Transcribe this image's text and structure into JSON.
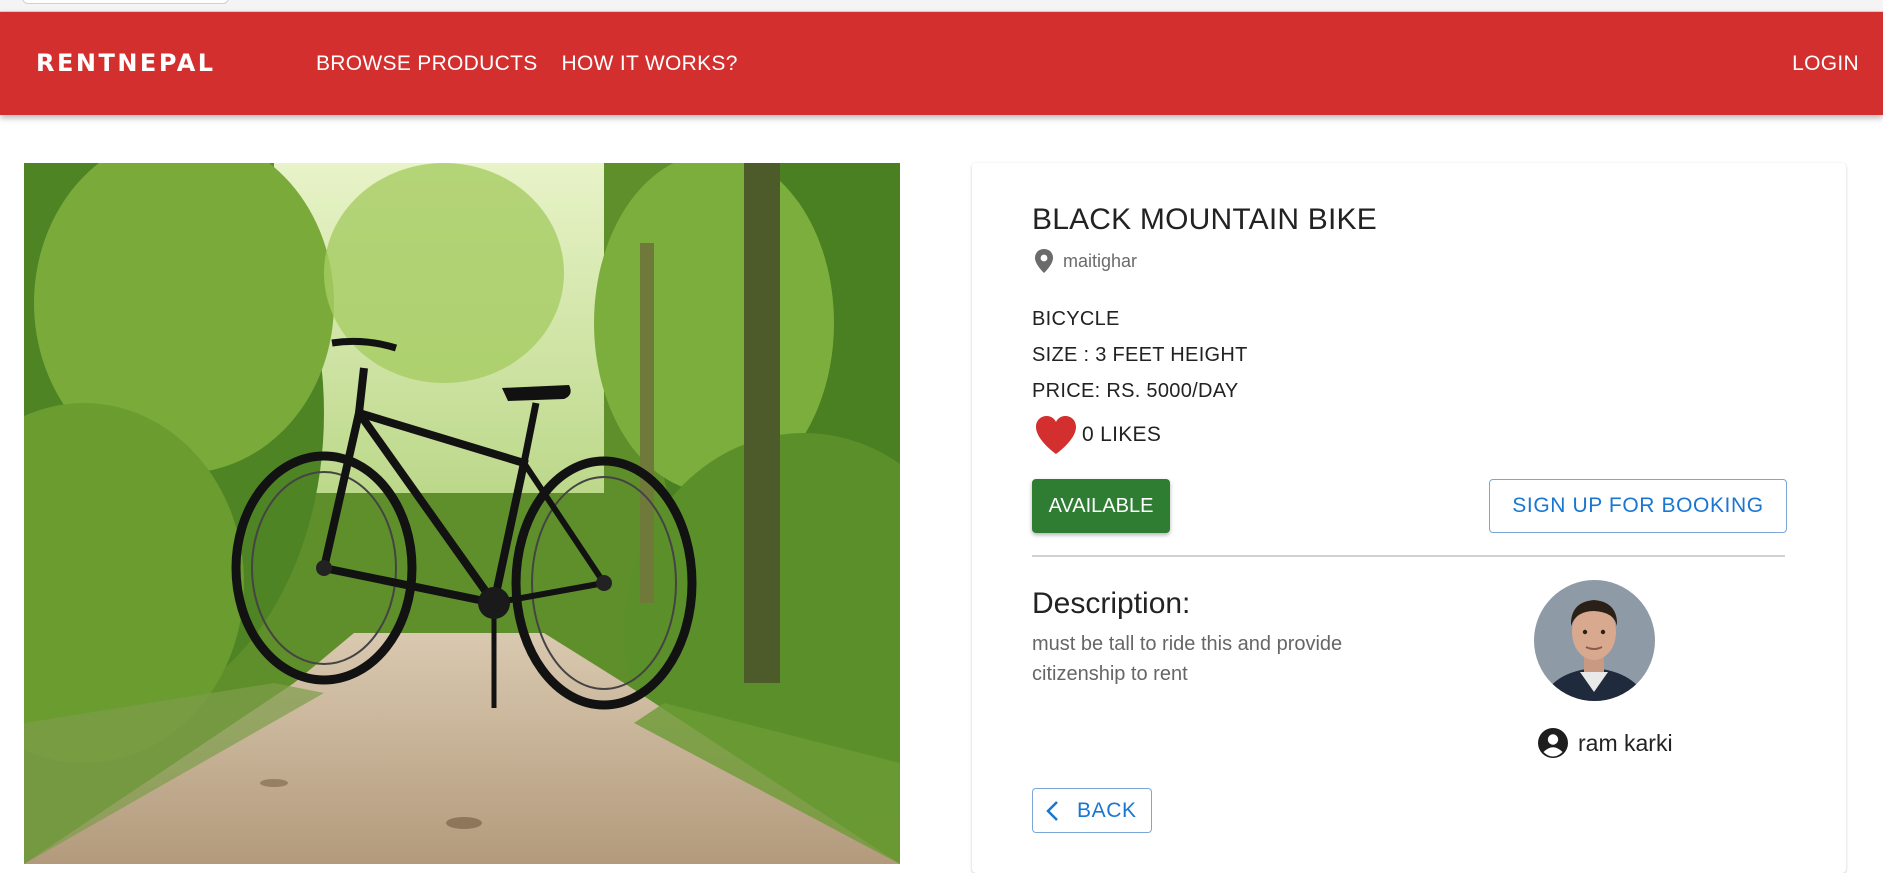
{
  "browser": {
    "tab_pill": ""
  },
  "appbar": {
    "brand": "RENTNEPAL",
    "nav": [
      "BROWSE PRODUCTS",
      "HOW IT WORKS?"
    ],
    "login_label": "LOGIN",
    "color": "#d32f2f"
  },
  "product": {
    "image_icon": "bicycle-photo",
    "title": "BLACK MOUNTAIN BIKE",
    "location": "maitighar",
    "location_icon": "location-pin-icon",
    "category": "BICYCLE",
    "size": "SIZE : 3 FEET HEIGHT",
    "price": "PRICE: RS. 5000/DAY",
    "likes": "0 LIKES",
    "like_icon": "heart-icon",
    "status_label": "AVAILABLE",
    "status_color": "#2e7d32",
    "booking_label": "SIGN UP FOR BOOKING",
    "description_heading": "Description:",
    "description": "must be tall to ride this and provide citizenship to rent",
    "back_label": "BACK",
    "back_icon": "chevron-left-icon",
    "accent_color": "#1976d2"
  },
  "owner": {
    "name": "ram karki",
    "icon": "account-circle-icon",
    "avatar": "owner-avatar"
  }
}
